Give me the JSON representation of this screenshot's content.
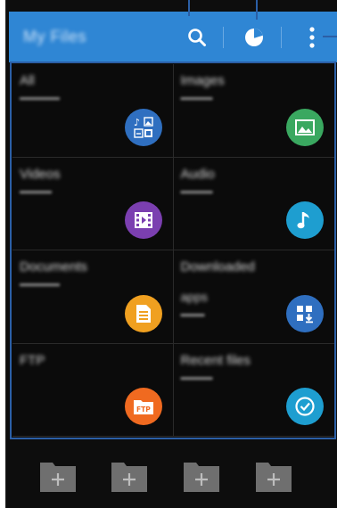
{
  "action_bar": {
    "title": "My Files",
    "color": "#2f86d4",
    "search_icon": "search-icon",
    "storage_icon": "pie-chart-icon",
    "menu_icon": "more-vert-icon"
  },
  "categories": [
    {
      "title": "All",
      "sub": "",
      "icon": "all-files-icon",
      "color": "#2f6fc0"
    },
    {
      "title": "Images",
      "sub": "",
      "icon": "image-icon",
      "color": "#3aa860"
    },
    {
      "title": "Videos",
      "sub": "",
      "icon": "video-icon",
      "color": "#7b3fb0"
    },
    {
      "title": "Audio",
      "sub": "",
      "icon": "music-icon",
      "color": "#1e9ed0"
    },
    {
      "title": "Documents",
      "sub": "",
      "icon": "document-icon",
      "color": "#f0a020"
    },
    {
      "title": "Downloaded",
      "sub": "apps",
      "icon": "download-icon",
      "color": "#2f6fc0"
    },
    {
      "title": "FTP",
      "sub": "",
      "icon": "ftp-icon",
      "color": "#f06a20"
    },
    {
      "title": "Recent files",
      "sub": "",
      "icon": "clock-icon",
      "color": "#1e9ed0"
    }
  ],
  "shortcut_folders": [
    {
      "icon": "add-folder-icon"
    },
    {
      "icon": "add-folder-icon"
    },
    {
      "icon": "add-folder-icon"
    },
    {
      "icon": "add-folder-icon"
    }
  ],
  "callout_color": "#2b5fa6"
}
